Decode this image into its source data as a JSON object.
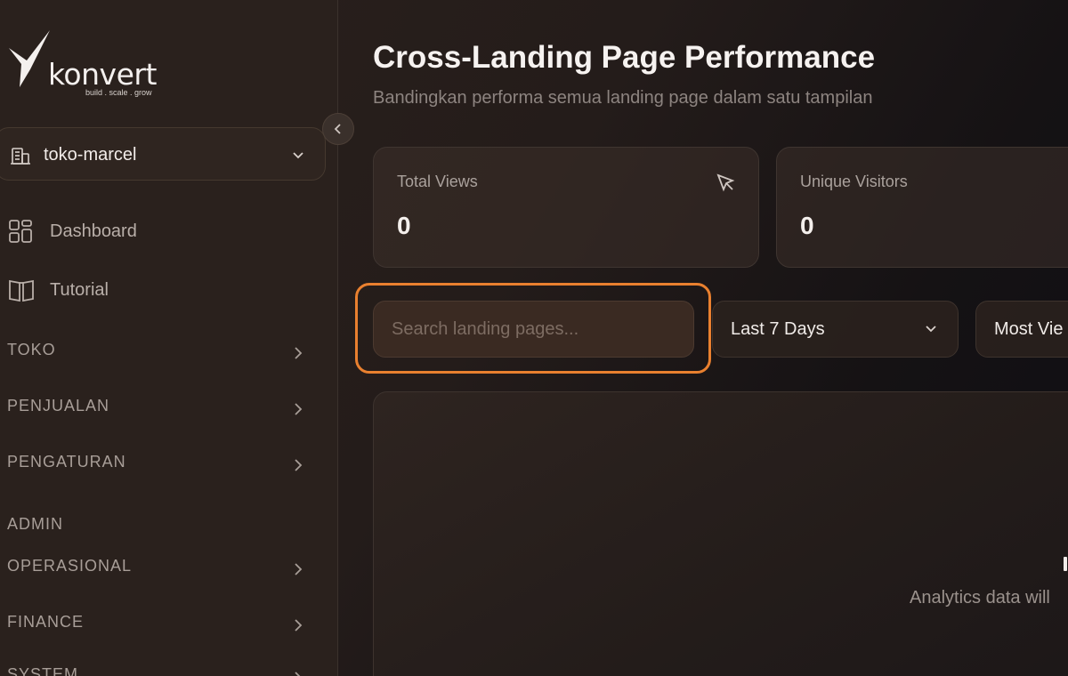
{
  "brand": {
    "name": "konvert",
    "tagline": "build . scale . grow"
  },
  "store_selector": {
    "value": "toko-marcel"
  },
  "nav": {
    "items": [
      {
        "label": "Dashboard",
        "icon": "grid-icon"
      },
      {
        "label": "Tutorial",
        "icon": "book-icon"
      }
    ],
    "sections": [
      {
        "label": "TOKO",
        "has_chevron": true
      },
      {
        "label": "PENJUALAN",
        "has_chevron": true
      },
      {
        "label": "PENGATURAN",
        "has_chevron": true
      },
      {
        "label": "ADMIN",
        "has_chevron": false
      },
      {
        "label": "OPERASIONAL",
        "has_chevron": true
      },
      {
        "label": "FINANCE",
        "has_chevron": true
      },
      {
        "label": "SYSTEM",
        "has_chevron": true
      }
    ]
  },
  "header": {
    "title": "Cross-Landing Page Performance",
    "subtitle": "Bandingkan performa semua landing page dalam satu tampilan"
  },
  "stats": [
    {
      "label": "Total Views",
      "value": "0",
      "icon": "cursor-click-icon"
    },
    {
      "label": "Unique Visitors",
      "value": "0"
    }
  ],
  "filters": {
    "search_placeholder": "Search landing pages...",
    "date_range": "Last 7 Days",
    "sort": "Most Vie"
  },
  "empty_state": {
    "text": "Analytics data will"
  },
  "colors": {
    "accent": "#e9802f",
    "sidebar_bg": "#2a211d",
    "text_primary": "#f6f2f0",
    "text_muted": "#8d8480"
  }
}
